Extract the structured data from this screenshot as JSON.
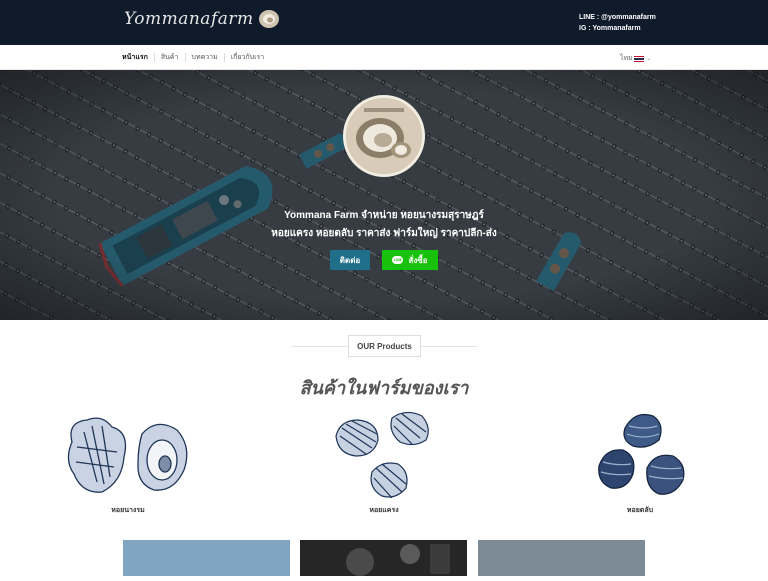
{
  "header": {
    "logo_text": "Yommanafarm",
    "line_contact": "LINE : @yommanafarm",
    "ig_contact": "IG : Yommanafarm"
  },
  "nav": {
    "items": [
      "หน้าแรก",
      "สินค้า",
      "บทความ",
      "เกี่ยวกับเรา"
    ],
    "language": "ไทย"
  },
  "hero": {
    "line1": "Yommana Farm จำหน่าย หอยนางรมสุราษฎร์",
    "line2": "หอยแครง หอยตลับ ราคาส่ง ฟาร์มใหญ่ ราคาปลีก-ส่ง",
    "contact_button": "ติดต่อ",
    "order_button": "สั่งซื้อ",
    "line_badge": "LINE"
  },
  "products": {
    "badge": "OUR Products",
    "title": "สินค้าในฟาร์มของเรา",
    "items": [
      {
        "label": "หอยนางรม",
        "icon": "oyster-icon"
      },
      {
        "label": "หอยแครง",
        "icon": "cockle-icon"
      },
      {
        "label": "หอยตลับ",
        "icon": "clam-icon"
      }
    ]
  },
  "colors": {
    "header_bg": "#0f1a2b",
    "contact_button": "#1f6f8b",
    "order_button": "#19c20a"
  }
}
